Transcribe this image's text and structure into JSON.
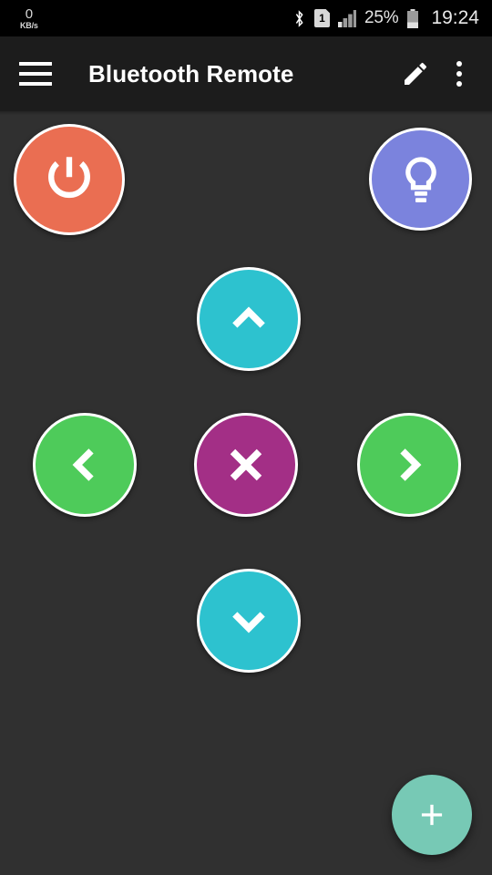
{
  "status_bar": {
    "network_speed_value": "0",
    "network_speed_unit": "KB/s",
    "bluetooth_icon": "bluetooth-icon",
    "sim_label": "1",
    "signal_icon": "signal-bars-icon",
    "battery_percent": "25%",
    "battery_icon": "battery-icon",
    "clock": "19:24"
  },
  "app_bar": {
    "menu_icon": "hamburger-menu-icon",
    "title": "Bluetooth Remote",
    "edit_icon": "pencil-edit-icon",
    "overflow_icon": "more-vertical-icon"
  },
  "remote": {
    "buttons": [
      {
        "name": "power",
        "icon": "power-icon",
        "color": "#ea6e52"
      },
      {
        "name": "light",
        "icon": "lightbulb-icon",
        "color": "#7b83dd"
      },
      {
        "name": "up",
        "icon": "chevron-up-icon",
        "color": "#2dc2cf"
      },
      {
        "name": "left",
        "icon": "chevron-left-icon",
        "color": "#4ecb5a"
      },
      {
        "name": "ok",
        "icon": "close-x-icon",
        "color": "#a32f86"
      },
      {
        "name": "right",
        "icon": "chevron-right-icon",
        "color": "#4ecb5a"
      },
      {
        "name": "down",
        "icon": "chevron-down-icon",
        "color": "#2dc2cf"
      }
    ]
  },
  "fab": {
    "icon": "plus-icon",
    "color": "#77c9b5"
  },
  "theme": {
    "background": "#303030",
    "app_bar_background": "#1c1c1c",
    "status_bar_background": "#000000",
    "text_color": "#ffffff"
  }
}
